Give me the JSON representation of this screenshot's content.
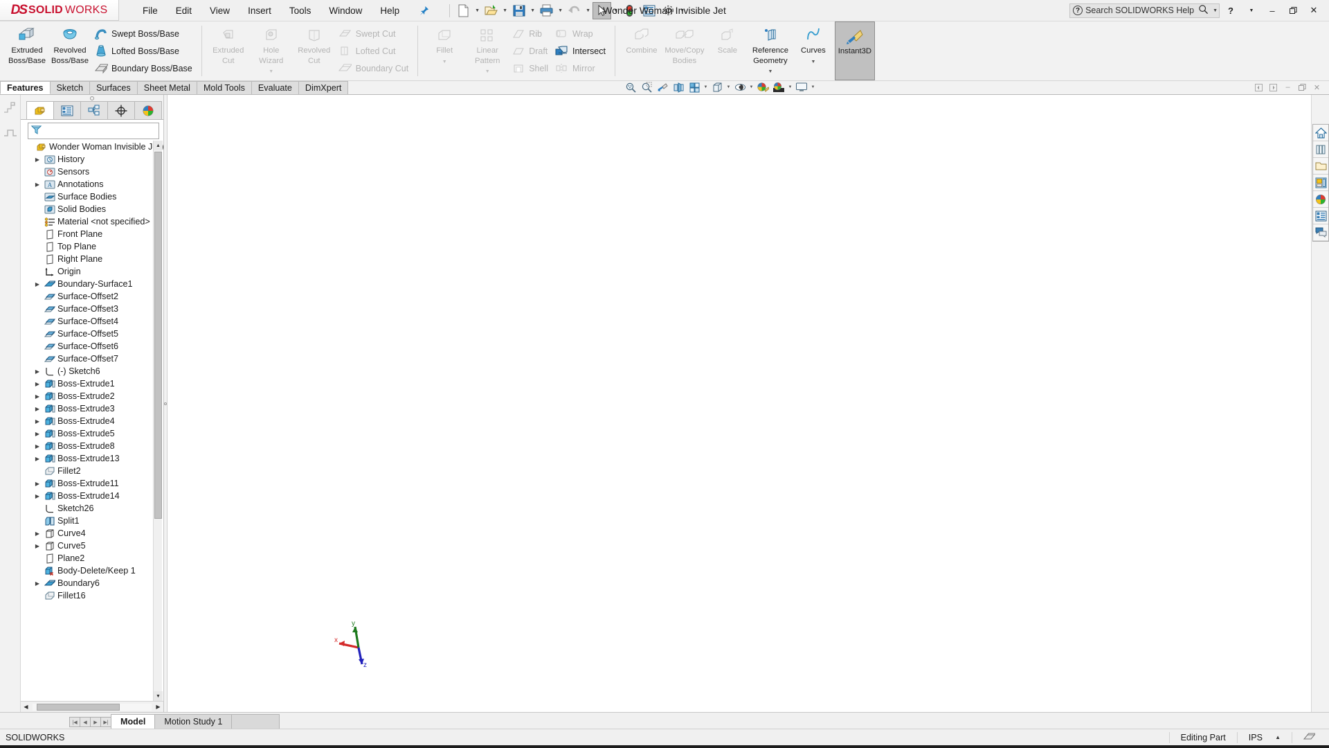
{
  "app": {
    "brand_ds": "DS",
    "brand_solid": "SOLID",
    "brand_works": "WORKS",
    "status_text": "SOLIDWORKS"
  },
  "title_bar": {
    "document_title": "Wonder Woman Invisible Jet",
    "menus": [
      "File",
      "Edit",
      "View",
      "Insert",
      "Tools",
      "Window",
      "Help"
    ],
    "pin_icon": "pushpin-icon",
    "quick_access": [
      {
        "name": "new-document-button",
        "icon": "new-document-icon",
        "has_caret": true
      },
      {
        "name": "open-document-button",
        "icon": "open-folder-icon",
        "has_caret": true
      },
      {
        "name": "save-button",
        "icon": "floppy-disk-icon",
        "has_caret": true
      },
      {
        "name": "print-button",
        "icon": "printer-icon",
        "has_caret": true
      },
      {
        "name": "undo-button",
        "icon": "undo-arrow-icon",
        "has_caret": true
      },
      {
        "name": "select-button",
        "icon": "cursor-arrow-icon",
        "has_caret": true,
        "selected": true
      },
      {
        "name": "rebuild-button",
        "icon": "traffic-light-icon",
        "has_caret": false
      },
      {
        "name": "options-display-button",
        "icon": "list-properties-icon",
        "has_caret": false
      },
      {
        "name": "options-button",
        "icon": "gear-icon",
        "has_caret": true
      }
    ],
    "help_search_placeholder": "Search SOLIDWORKS Help",
    "help_label": "?",
    "window_controls": {
      "minimize": "–",
      "maximize": "❐",
      "close": "✕"
    }
  },
  "ribbon": {
    "groups": [
      {
        "name": "boss-group",
        "big": [
          {
            "label": "Extruded\nBoss/Base",
            "label1": "Extruded",
            "label2": "Boss/Base",
            "icon": "extruded-boss-icon",
            "disabled": false,
            "caret": false
          },
          {
            "label1": "Revolved",
            "label2": "Boss/Base",
            "icon": "revolved-boss-icon",
            "disabled": false,
            "caret": false
          }
        ],
        "small": [
          {
            "label": "Swept Boss/Base",
            "icon": "swept-boss-icon",
            "disabled": false
          },
          {
            "label": "Lofted Boss/Base",
            "icon": "lofted-boss-icon",
            "disabled": false
          },
          {
            "label": "Boundary Boss/Base",
            "icon": "boundary-boss-icon",
            "disabled": false
          }
        ]
      },
      {
        "name": "cut-group",
        "big": [
          {
            "label1": "Extruded",
            "label2": "Cut",
            "icon": "extruded-cut-icon",
            "disabled": true,
            "caret": false
          },
          {
            "label1": "Hole",
            "label2": "Wizard",
            "icon": "hole-wizard-icon",
            "disabled": true,
            "caret": true
          },
          {
            "label1": "Revolved",
            "label2": "Cut",
            "icon": "revolved-cut-icon",
            "disabled": true,
            "caret": false
          }
        ],
        "small": [
          {
            "label": "Swept Cut",
            "icon": "swept-cut-icon",
            "disabled": true
          },
          {
            "label": "Lofted Cut",
            "icon": "lofted-cut-icon",
            "disabled": true
          },
          {
            "label": "Boundary Cut",
            "icon": "boundary-cut-icon",
            "disabled": true
          }
        ]
      },
      {
        "name": "feature-group",
        "big": [
          {
            "label1": "Fillet",
            "label2": "",
            "icon": "fillet-icon",
            "disabled": true,
            "caret": true
          },
          {
            "label1": "Linear",
            "label2": "Pattern",
            "icon": "linear-pattern-icon",
            "disabled": true,
            "caret": true
          }
        ],
        "small": [
          {
            "label": "Rib",
            "icon": "rib-icon",
            "disabled": true
          },
          {
            "label": "Draft",
            "icon": "draft-icon",
            "disabled": true
          },
          {
            "label": "Shell",
            "icon": "shell-icon",
            "disabled": true
          }
        ],
        "small2": [
          {
            "label": "Wrap",
            "icon": "wrap-icon",
            "disabled": true
          },
          {
            "label": "Intersect",
            "icon": "intersect-icon",
            "disabled": false
          },
          {
            "label": "Mirror",
            "icon": "mirror-icon",
            "disabled": true
          }
        ]
      },
      {
        "name": "bodies-group",
        "big": [
          {
            "label1": "Combine",
            "label2": "",
            "icon": "combine-icon",
            "disabled": true,
            "caret": false
          },
          {
            "label1": "Move/Copy",
            "label2": "Bodies",
            "icon": "move-copy-bodies-icon",
            "disabled": true,
            "caret": false
          },
          {
            "label1": "Scale",
            "label2": "",
            "icon": "scale-icon",
            "disabled": true,
            "caret": false
          },
          {
            "label1": "Reference",
            "label2": "Geometry",
            "icon": "reference-geometry-icon",
            "disabled": false,
            "caret": true
          },
          {
            "label1": "Curves",
            "label2": "",
            "icon": "curves-icon",
            "disabled": false,
            "caret": true
          },
          {
            "label1": "Instant3D",
            "label2": "",
            "icon": "instant3d-icon",
            "disabled": false,
            "caret": false,
            "active": true
          }
        ]
      }
    ]
  },
  "command_tabs": {
    "items": [
      "Features",
      "Sketch",
      "Surfaces",
      "Sheet Metal",
      "Mold Tools",
      "Evaluate",
      "DimXpert"
    ],
    "selected": "Features"
  },
  "view_toolbar": [
    {
      "name": "zoom-to-fit-button",
      "icon": "zoom-to-fit-icon",
      "caret": false
    },
    {
      "name": "zoom-to-area-button",
      "icon": "zoom-area-icon",
      "caret": false
    },
    {
      "name": "previous-view-button",
      "icon": "previous-view-icon",
      "caret": false
    },
    {
      "name": "section-view-button",
      "icon": "section-view-icon",
      "caret": false
    },
    {
      "name": "view-orientation-button",
      "icon": "view-orientation-icon",
      "caret": true
    },
    {
      "name": "display-style-button",
      "icon": "display-style-icon",
      "caret": true
    },
    {
      "name": "hide-show-items-button",
      "icon": "hide-show-eye-icon",
      "caret": true
    },
    {
      "name": "edit-appearance-button",
      "icon": "appearance-palette-icon",
      "caret": false
    },
    {
      "name": "apply-scene-button",
      "icon": "scene-icon",
      "caret": true
    },
    {
      "name": "view-settings-button",
      "icon": "monitor-icon",
      "caret": true
    }
  ],
  "document_window_controls": [
    {
      "name": "restore-left-button",
      "glyph": "◀"
    },
    {
      "name": "restore-right-button",
      "glyph": "▶"
    },
    {
      "name": "doc-minimize-button",
      "glyph": "–"
    },
    {
      "name": "doc-restore-button",
      "glyph": "❐"
    },
    {
      "name": "doc-close-button",
      "glyph": "✕"
    }
  ],
  "left_rail": [
    {
      "name": "rollback-bar-icon",
      "icon": "rollback-steps-icon"
    },
    {
      "name": "freeze-bar-icon",
      "icon": "freeze-bar-icon"
    }
  ],
  "feature_manager": {
    "tabs": [
      {
        "name": "feature-manager-tab",
        "icon": "feature-tree-icon",
        "selected": true
      },
      {
        "name": "property-manager-tab",
        "icon": "property-list-icon",
        "selected": false
      },
      {
        "name": "configuration-manager-tab",
        "icon": "configuration-icon",
        "selected": false
      },
      {
        "name": "dimxpert-manager-tab",
        "icon": "dimxpert-target-icon",
        "selected": false
      },
      {
        "name": "display-manager-tab",
        "icon": "display-sphere-icon",
        "selected": false
      }
    ],
    "filter_icon": "filter-funnel-icon",
    "filter_value": "",
    "filter_placeholder": "",
    "tree": [
      {
        "label": "Wonder Woman Invisible Jet  (D",
        "icon": "part-document-icon",
        "arrow": false,
        "indent": 0,
        "root": true
      },
      {
        "label": "History",
        "icon": "history-icon",
        "arrow": true,
        "indent": 1
      },
      {
        "label": "Sensors",
        "icon": "sensors-icon",
        "arrow": false,
        "indent": 1
      },
      {
        "label": "Annotations",
        "icon": "annotations-icon",
        "arrow": true,
        "indent": 1
      },
      {
        "label": "Surface Bodies",
        "icon": "surface-bodies-icon",
        "arrow": false,
        "indent": 1
      },
      {
        "label": "Solid Bodies",
        "icon": "solid-bodies-icon",
        "arrow": false,
        "indent": 1
      },
      {
        "label": "Material <not specified>",
        "icon": "material-icon",
        "arrow": false,
        "indent": 1
      },
      {
        "label": "Front Plane",
        "icon": "plane-icon",
        "arrow": false,
        "indent": 1
      },
      {
        "label": "Top Plane",
        "icon": "plane-icon",
        "arrow": false,
        "indent": 1
      },
      {
        "label": "Right Plane",
        "icon": "plane-icon",
        "arrow": false,
        "indent": 1
      },
      {
        "label": "Origin",
        "icon": "origin-icon",
        "arrow": false,
        "indent": 1
      },
      {
        "label": "Boundary-Surface1",
        "icon": "boundary-surface-icon",
        "arrow": true,
        "indent": 1
      },
      {
        "label": "Surface-Offset2",
        "icon": "surface-offset-icon",
        "arrow": false,
        "indent": 1
      },
      {
        "label": "Surface-Offset3",
        "icon": "surface-offset-icon",
        "arrow": false,
        "indent": 1
      },
      {
        "label": "Surface-Offset4",
        "icon": "surface-offset-icon",
        "arrow": false,
        "indent": 1
      },
      {
        "label": "Surface-Offset5",
        "icon": "surface-offset-icon",
        "arrow": false,
        "indent": 1
      },
      {
        "label": "Surface-Offset6",
        "icon": "surface-offset-icon",
        "arrow": false,
        "indent": 1
      },
      {
        "label": "Surface-Offset7",
        "icon": "surface-offset-icon",
        "arrow": false,
        "indent": 1
      },
      {
        "label": "(-) Sketch6",
        "icon": "sketch-icon",
        "arrow": true,
        "indent": 1
      },
      {
        "label": "Boss-Extrude1",
        "icon": "boss-extrude-icon",
        "arrow": true,
        "indent": 1
      },
      {
        "label": "Boss-Extrude2",
        "icon": "boss-extrude-icon",
        "arrow": true,
        "indent": 1
      },
      {
        "label": "Boss-Extrude3",
        "icon": "boss-extrude-icon",
        "arrow": true,
        "indent": 1
      },
      {
        "label": "Boss-Extrude4",
        "icon": "boss-extrude-icon",
        "arrow": true,
        "indent": 1
      },
      {
        "label": "Boss-Extrude5",
        "icon": "boss-extrude-icon",
        "arrow": true,
        "indent": 1
      },
      {
        "label": "Boss-Extrude8",
        "icon": "boss-extrude-icon",
        "arrow": true,
        "indent": 1
      },
      {
        "label": "Boss-Extrude13",
        "icon": "boss-extrude-icon",
        "arrow": true,
        "indent": 1
      },
      {
        "label": "Fillet2",
        "icon": "fillet-tree-icon",
        "arrow": false,
        "indent": 1
      },
      {
        "label": "Boss-Extrude11",
        "icon": "boss-extrude-icon",
        "arrow": true,
        "indent": 1
      },
      {
        "label": "Boss-Extrude14",
        "icon": "boss-extrude-icon",
        "arrow": true,
        "indent": 1
      },
      {
        "label": "Sketch26",
        "icon": "sketch-icon",
        "arrow": false,
        "indent": 1
      },
      {
        "label": "Split1",
        "icon": "split-icon",
        "arrow": false,
        "indent": 1
      },
      {
        "label": "Curve4",
        "icon": "curve-icon",
        "arrow": true,
        "indent": 1
      },
      {
        "label": "Curve5",
        "icon": "curve-icon",
        "arrow": true,
        "indent": 1
      },
      {
        "label": "Plane2",
        "icon": "plane-icon",
        "arrow": false,
        "indent": 1
      },
      {
        "label": "Body-Delete/Keep 1",
        "icon": "body-delete-keep-icon",
        "arrow": false,
        "indent": 1
      },
      {
        "label": "Boundary6",
        "icon": "boundary-surface-icon",
        "arrow": true,
        "indent": 1
      },
      {
        "label": "Fillet16",
        "icon": "fillet-tree-icon",
        "arrow": false,
        "indent": 1
      }
    ]
  },
  "task_pane": [
    {
      "name": "task-pane-home-button",
      "icon": "home-icon"
    },
    {
      "name": "task-pane-design-library-button",
      "icon": "design-library-icon"
    },
    {
      "name": "task-pane-file-explorer-button",
      "icon": "folder-icon"
    },
    {
      "name": "task-pane-view-palette-button",
      "icon": "view-palette-icon"
    },
    {
      "name": "task-pane-appearances-button",
      "icon": "appearances-sphere-icon"
    },
    {
      "name": "task-pane-custom-properties-button",
      "icon": "custom-properties-icon"
    },
    {
      "name": "task-pane-forum-button",
      "icon": "chat-bubbles-icon"
    }
  ],
  "triad": {
    "x_label": "x",
    "y_label": "y",
    "z_label": "z",
    "x_color": "#d42b2b",
    "y_color": "#1d7a1d",
    "z_color": "#2222bb"
  },
  "bottom_tabs": {
    "nav_buttons": [
      "◀│",
      "◀",
      "▶",
      "│▶"
    ],
    "items": [
      {
        "label": "Model",
        "selected": true
      },
      {
        "label": "Motion Study 1",
        "selected": false
      }
    ]
  },
  "status_bar": {
    "left": "SOLIDWORKS",
    "editing": "Editing Part",
    "units": "IPS",
    "units_caret": "▲",
    "overlay_icon": "document-overlay-icon"
  }
}
